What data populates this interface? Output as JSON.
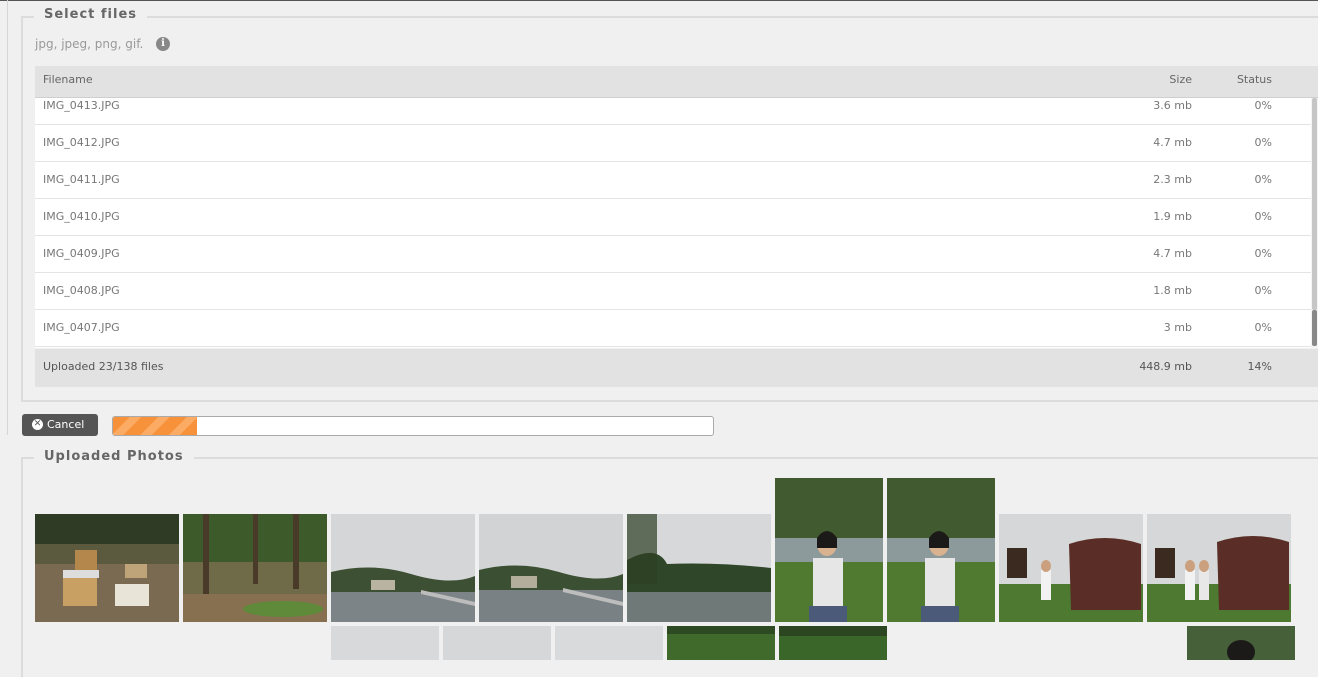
{
  "select_files": {
    "legend": "Select files",
    "filetypes": "jpg, jpeg, png, gif.",
    "info_icon": "i",
    "columns": {
      "filename": "Filename",
      "size": "Size",
      "status": "Status"
    },
    "rows": [
      {
        "name": "IMG_0413.JPG",
        "size": "3.6 mb",
        "status": "0%"
      },
      {
        "name": "IMG_0412.JPG",
        "size": "4.7 mb",
        "status": "0%"
      },
      {
        "name": "IMG_0411.JPG",
        "size": "2.3 mb",
        "status": "0%"
      },
      {
        "name": "IMG_0410.JPG",
        "size": "1.9 mb",
        "status": "0%"
      },
      {
        "name": "IMG_0409.JPG",
        "size": "4.7 mb",
        "status": "0%"
      },
      {
        "name": "IMG_0408.JPG",
        "size": "1.8 mb",
        "status": "0%"
      },
      {
        "name": "IMG_0407.JPG",
        "size": "3 mb",
        "status": "0%"
      }
    ],
    "footer": {
      "summary": "Uploaded 23/138 files",
      "total_size": "448.9 mb",
      "percent": "14%"
    }
  },
  "cancel_button": {
    "label": "Cancel",
    "icon": "x-circle-icon",
    "glyph": "✕"
  },
  "progress": {
    "value": 0.14,
    "color": "#f7913a"
  },
  "uploaded_photos": {
    "legend": "Uploaded Photos",
    "photos": [
      {
        "scene": "beehives",
        "subject": "beehives-in-forest"
      },
      {
        "scene": "forest",
        "subject": "trees-path"
      },
      {
        "scene": "reservoir",
        "subject": "reservoir-dam"
      },
      {
        "scene": "reservoir",
        "subject": "reservoir-dam"
      },
      {
        "scene": "lake",
        "subject": "lake-hills"
      },
      {
        "scene": "portrait",
        "subject": "girl-by-lake"
      },
      {
        "scene": "portrait",
        "subject": "girl-by-lake"
      },
      {
        "scene": "rock",
        "subject": "person-by-stone"
      },
      {
        "scene": "rock",
        "subject": "people-by-stone"
      },
      {
        "scene": "sky",
        "subject": "partial-sky"
      },
      {
        "scene": "sky",
        "subject": "partial-sky"
      },
      {
        "scene": "sky",
        "subject": "partial-sky"
      },
      {
        "scene": "greenery",
        "subject": "partial-trees"
      },
      {
        "scene": "greenery",
        "subject": "partial-trees"
      },
      {
        "scene": "portrait",
        "subject": "partial-girl"
      }
    ]
  }
}
